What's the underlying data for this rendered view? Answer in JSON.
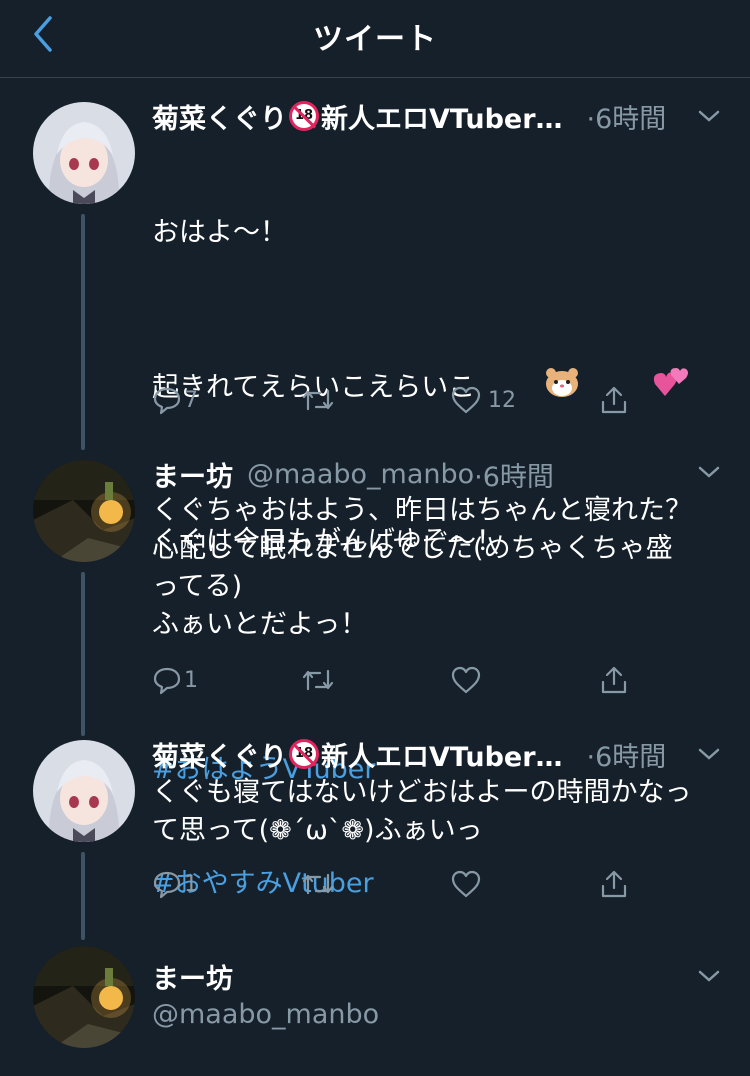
{
  "header": {
    "title": "ツイート"
  },
  "tweets": [
    {
      "name_a": "菊菜くぐり",
      "name_b": "新人エロVTuber…",
      "time": "·6時間",
      "lines": [
        "おはよ〜！",
        "起きれてえらいこえらいこ",
        "くぐは今日もがんばゆぞ〜！"
      ],
      "hashtags": [
        "#おはようVTuber",
        "#おやすみVtuber"
      ],
      "reply_count": "7",
      "like_count": "12"
    },
    {
      "name": "まー坊",
      "handle": "@maabo_manbo",
      "time": "·6時間",
      "text": "くぐちゃおはよう、昨日はちゃんと寝れた？\n心配して眠れませんでした(めちゃくちゃ盛\nってる)\nふぁいとだよっ！",
      "reply_count": "1"
    },
    {
      "name_a": "菊菜くぐり",
      "name_b": "新人エロVTuber…",
      "time": "·6時間",
      "text": "くぐも寝てはないけどおはよーの時間かなっ\nて思って(❁´ω`❁)ふぁいっ",
      "reply_count": "1"
    },
    {
      "name": "まー坊",
      "handle": "@maabo_manbo"
    }
  ],
  "colors": {
    "background": "#15202b",
    "accent": "#4a9fe0",
    "secondary_text": "#8899a6"
  }
}
